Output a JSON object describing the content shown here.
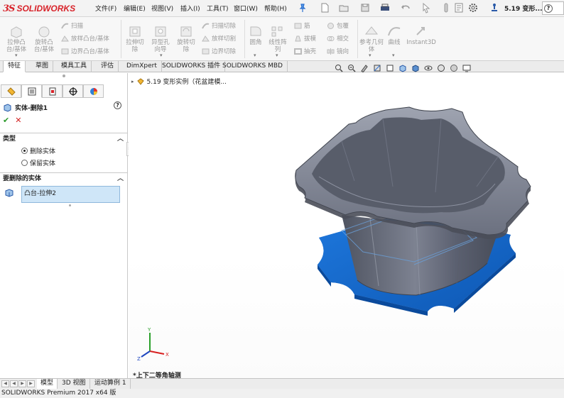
{
  "app": {
    "brand": "SOLIDWORKS",
    "document_title": "5.19 变形..."
  },
  "menu": {
    "items": [
      "文件(F)",
      "编辑(E)",
      "视图(V)",
      "插入(I)",
      "工具(T)",
      "窗口(W)",
      "帮助(H)"
    ]
  },
  "ribbon": {
    "extrude_boss": "拉伸凸台/基体",
    "revolve_boss": "旋转凸台/基体",
    "sweep": "扫描",
    "loft_boss": "放样凸台/基体",
    "boundary_boss": "边界凸台/基体",
    "extrude_cut": "拉伸切除",
    "hole_wizard": "异型孔向导",
    "revolve_cut": "旋转切除",
    "sweep_cut": "扫描切除",
    "loft_cut": "放样切割",
    "boundary_cut": "边界切除",
    "fillet": "圆角",
    "linear_pattern": "线性阵列",
    "rib": "筋",
    "draft": "拔模",
    "shell": "抽壳",
    "wrap": "包覆",
    "intersect": "相交",
    "mirror": "镜向",
    "ref_geometry": "参考几何体",
    "curves": "曲线",
    "instant3d": "Instant3D"
  },
  "command_tabs": [
    "特征",
    "草图",
    "模具工具",
    "评估",
    "DimXpert",
    "SOLIDWORKS 插件",
    "SOLIDWORKS MBD"
  ],
  "tree": {
    "root_label": "5.19 变形实例（花盆建模..."
  },
  "property_manager": {
    "title": "实体-删除1",
    "help": "?",
    "ok": "✔",
    "cancel": "✕",
    "section_type": "类型",
    "option_delete": "删除实体",
    "option_keep": "保留实体",
    "section_bodies": "要删除的实体",
    "selected_body": "凸台-拉伸2"
  },
  "graphics": {
    "view_orientation": "*上下二等角轴测",
    "triad_x": "X",
    "triad_y": "Y",
    "triad_z": "Z"
  },
  "bottom_tabs": [
    "模型",
    "3D 视图",
    "运动算例 1"
  ],
  "status": {
    "text": "SOLIDWORKS Premium 2017 x64 版"
  },
  "colors": {
    "brand_red": "#d8232a",
    "selection_blue": "#1a6fd6",
    "pot_gray": "#6a6f7c",
    "ok_green": "#2a9a2a",
    "cancel_red": "#d32020"
  }
}
